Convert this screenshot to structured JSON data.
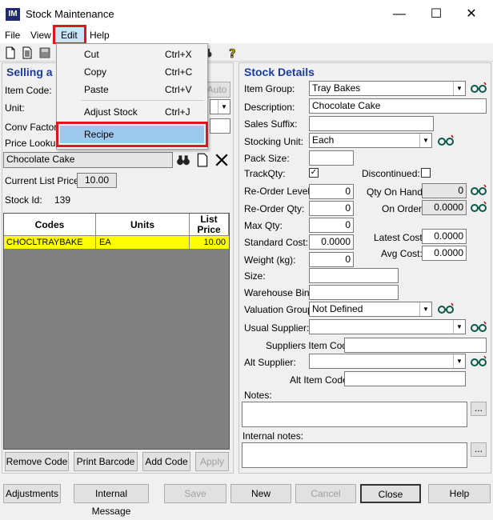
{
  "window": {
    "title": "Stock Maintenance",
    "icon_text": "IM",
    "minimize": "—",
    "maximize": "☐",
    "close": "✕"
  },
  "menu": {
    "file": "File",
    "view": "View",
    "edit": "Edit",
    "help": "Help"
  },
  "edit_menu": [
    {
      "label": "Cut",
      "shortcut": "Ctrl+X"
    },
    {
      "label": "Copy",
      "shortcut": "Ctrl+C"
    },
    {
      "label": "Paste",
      "shortcut": "Ctrl+V"
    },
    {
      "label": "Adjust Stock",
      "shortcut": "Ctrl+J"
    },
    {
      "label": "Recipe",
      "shortcut": ""
    }
  ],
  "left": {
    "title": "Selling a",
    "item_code_label": "Item Code:",
    "auto_button": "Auto",
    "unit_label": "Unit:",
    "conv_label": "Conv Factor",
    "price_lookup_label": "Price Lookup",
    "search_value": "Chocolate Cake",
    "list_price_label": "Current List Price:",
    "list_price_value": "10.00",
    "stock_id_label": "Stock Id:",
    "stock_id_value": "139",
    "grid": {
      "headers": [
        "Codes",
        "Units",
        "List Price"
      ],
      "rows": [
        {
          "code": "CHOCLTRAYBAKE",
          "unit": "EA",
          "price": "10.00"
        }
      ]
    },
    "remove_code": "Remove Code",
    "print_barcode": "Print Barcode",
    "add_code": "Add Code",
    "apply": "Apply"
  },
  "right": {
    "title": "Stock Details",
    "item_group_label": "Item Group:",
    "item_group_value": "Tray Bakes",
    "description_label": "Description:",
    "description_value": "Chocolate Cake",
    "sales_suffix_label": "Sales Suffix:",
    "stocking_unit_label": "Stocking Unit:",
    "stocking_unit_value": "Each",
    "pack_size_label": "Pack Size:",
    "trackqty_label": "TrackQty:",
    "trackqty_check": "✓",
    "discontinued_label": "Discontinued:",
    "reorder_level_label": "Re-Order Level:",
    "reorder_level_value": "0",
    "qty_on_hand_label": "Qty On Hand:",
    "qty_on_hand_value": "0",
    "reorder_qty_label": "Re-Order Qty:",
    "reorder_qty_value": "0",
    "on_order_label": "On Order:",
    "on_order_value": "0.0000",
    "max_qty_label": "Max Qty:",
    "max_qty_value": "0",
    "standard_cost_label": "Standard Cost:",
    "standard_cost_value": "0.0000",
    "latest_cost_label": "Latest Cost:",
    "latest_cost_value": "0.0000",
    "weight_label": "Weight (kg):",
    "weight_value": "0",
    "avg_cost_label": "Avg Cost:",
    "avg_cost_value": "0.0000",
    "size_label": "Size:",
    "warehouse_bin_label": "Warehouse Bin:",
    "valuation_group_label": "Valuation Group:",
    "valuation_group_value": "Not Defined",
    "usual_supplier_label": "Usual Supplier:",
    "suppliers_item_code_label": "Suppliers Item Code:",
    "alt_supplier_label": "Alt Supplier:",
    "alt_item_code_label": "Alt Item Code:",
    "notes_label": "Notes:",
    "internal_notes_label": "Internal notes:",
    "ellipsis": "..."
  },
  "bottom": {
    "adjustments": "Adjustments",
    "internal_message": "Internal Message",
    "save": "Save",
    "new": "New",
    "cancel": "Cancel",
    "close": "Close",
    "help": "Help"
  },
  "colors": {
    "accent_title": "#1a3c9c",
    "highlight_red": "#e0161e",
    "row_highlight": "#ffff00",
    "menu_selected": "#9ec9ef"
  }
}
